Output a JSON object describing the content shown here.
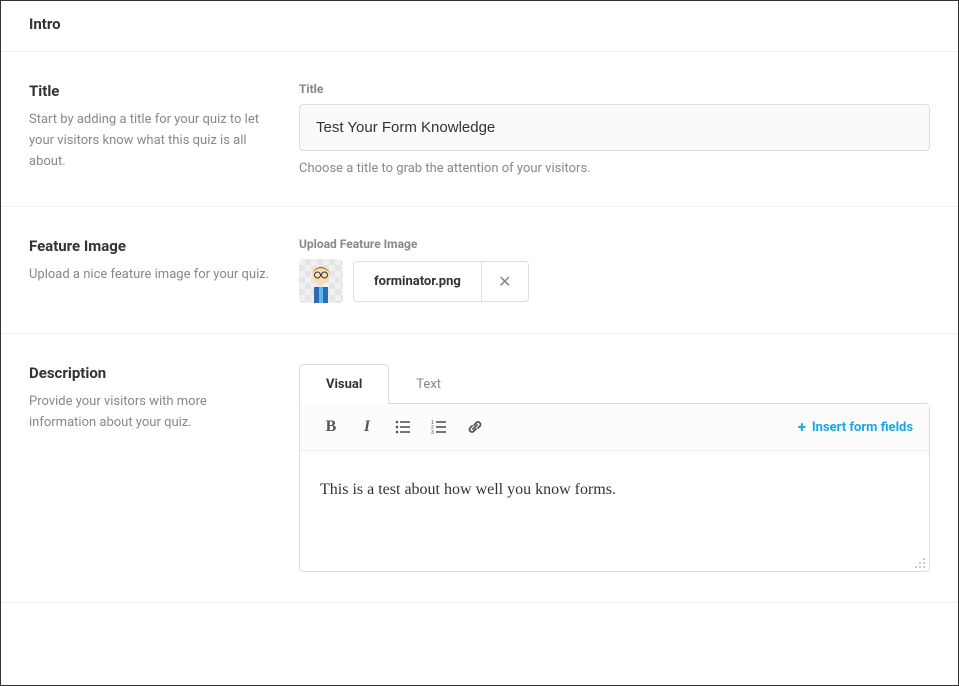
{
  "panel": {
    "header": "Intro"
  },
  "title_section": {
    "heading": "Title",
    "desc": "Start by adding a title for your quiz to let your visitors know what this quiz is all about.",
    "label": "Title",
    "value": "Test Your Form Knowledge",
    "help": "Choose a title to grab the attention of your visitors."
  },
  "feature_section": {
    "heading": "Feature Image",
    "desc": "Upload a nice feature image for your quiz.",
    "label": "Upload Feature Image",
    "file_name": "forminator.png"
  },
  "description_section": {
    "heading": "Description",
    "desc": "Provide your visitors with more information about your quiz.",
    "tabs": {
      "visual": "Visual",
      "text": "Text"
    },
    "toolbar": {
      "bold": "B",
      "italic": "I"
    },
    "insert_link": "Insert form fields",
    "content": "This is a test about how well you know forms."
  }
}
